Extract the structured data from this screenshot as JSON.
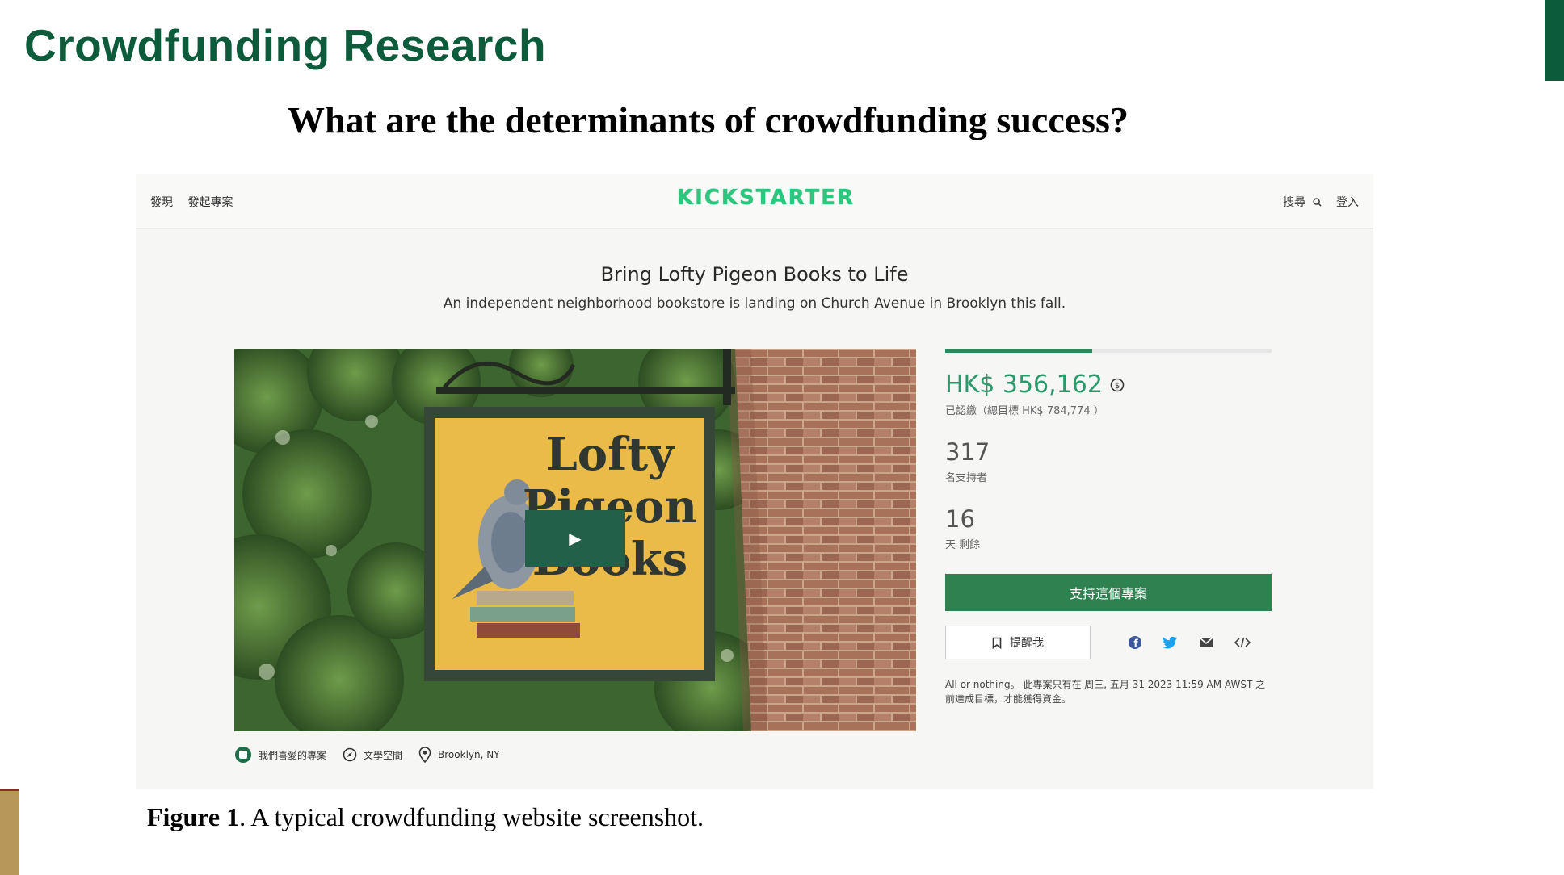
{
  "slide": {
    "title": "Crowdfunding Research",
    "question": "What are the determinants of crowdfunding success?",
    "caption_bold": "Figure 1",
    "caption_rest": ". A typical crowdfunding website screenshot.",
    "colors": {
      "title": "#0c5c3c",
      "accent_right": "#0c5c3c",
      "accent_left": "#b8975a"
    }
  },
  "kickstarter": {
    "nav": {
      "discover": "發現",
      "start_project": "發起專案",
      "logo": "KICKSTARTER",
      "search": "搜尋",
      "login": "登入"
    },
    "project": {
      "title": "Bring Lofty Pigeon Books to Life",
      "blurb": "An independent neighborhood bookstore is landing on Church Avenue in Brooklyn this fall.",
      "sign_line1": "Lofty",
      "sign_line2": "Pigeon",
      "sign_line3": "Books"
    },
    "funding": {
      "progress_fraction": 0.45,
      "pledged": "HK$ 356,162",
      "pledged_sub": "已認繳（總目標 HK$ 784,774 ）",
      "backers": "317",
      "backers_label": "名支持者",
      "days_left": "16",
      "days_label": "天 剩餘",
      "back_button": "支持這個專案",
      "remind_button": "提醒我",
      "aon_link": "All or nothing。",
      "aon_text": "此專案只有在 周三, 五月 31 2023 11:59 AM AWST 之前達成目標，才能獲得資金。"
    },
    "meta": {
      "projects_we_love": "我們喜愛的專案",
      "category": "文學空間",
      "location": "Brooklyn, NY"
    },
    "colors": {
      "logo": "#2bc77e",
      "pledged": "#2a9a6a",
      "button": "#2f8150",
      "progress": "#2a8a5c"
    },
    "icons": [
      "search-icon",
      "currency-convert-icon",
      "bookmark-icon",
      "facebook-icon",
      "twitter-icon",
      "email-icon",
      "embed-icon",
      "play-icon",
      "badge-icon",
      "compass-icon",
      "location-pin-icon"
    ]
  }
}
